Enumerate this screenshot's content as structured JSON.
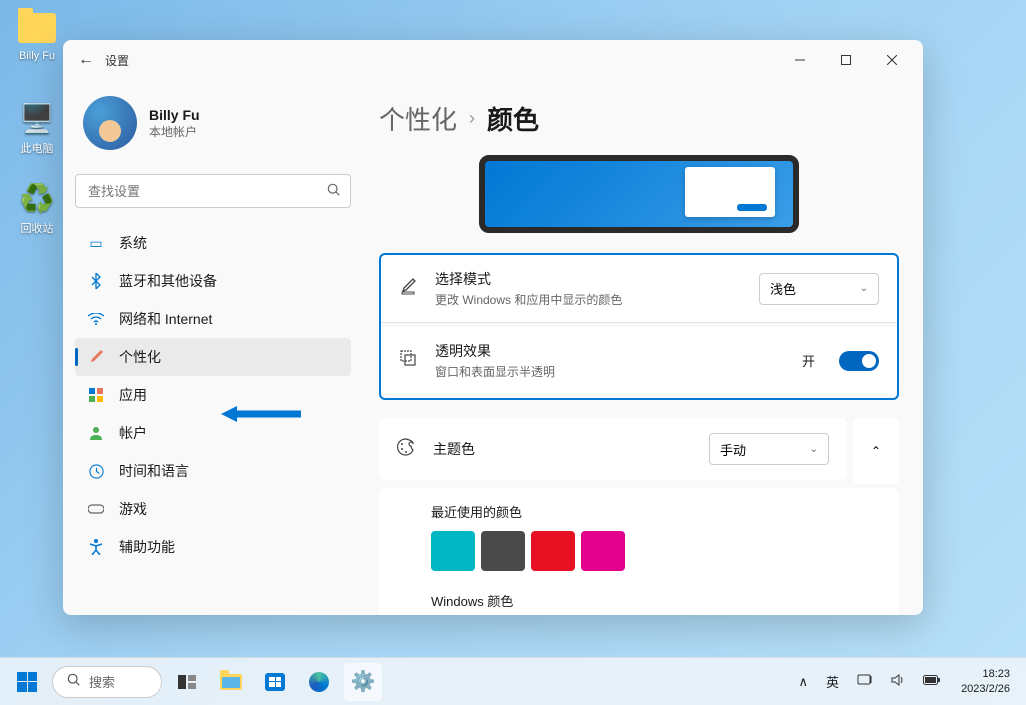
{
  "desktop": {
    "icons": [
      {
        "label": "Billy Fu",
        "type": "folder"
      },
      {
        "label": "此电脑",
        "type": "pc"
      },
      {
        "label": "回收站",
        "type": "recycle"
      }
    ]
  },
  "window": {
    "title": "设置",
    "back": "←"
  },
  "profile": {
    "name": "Billy Fu",
    "type": "本地帐户"
  },
  "search": {
    "placeholder": "查找设置"
  },
  "nav": [
    {
      "icon": "system",
      "label": "系统",
      "color": "#0078d4"
    },
    {
      "icon": "bluetooth",
      "label": "蓝牙和其他设备",
      "color": "#0078d4"
    },
    {
      "icon": "network",
      "label": "网络和 Internet",
      "color": "#0078d4"
    },
    {
      "icon": "personalize",
      "label": "个性化",
      "color": "#e8765c",
      "active": true
    },
    {
      "icon": "apps",
      "label": "应用",
      "color": "#0078d4"
    },
    {
      "icon": "accounts",
      "label": "帐户",
      "color": "#4caf50"
    },
    {
      "icon": "time",
      "label": "时间和语言",
      "color": "#0078d4"
    },
    {
      "icon": "gaming",
      "label": "游戏",
      "color": "#666"
    },
    {
      "icon": "accessibility",
      "label": "辅助功能",
      "color": "#0078d4"
    }
  ],
  "breadcrumb": {
    "parent": "个性化",
    "sep": "›",
    "current": "颜色"
  },
  "settings": {
    "mode": {
      "title": "选择模式",
      "sub": "更改 Windows 和应用中显示的颜色",
      "value": "浅色"
    },
    "transparency": {
      "title": "透明效果",
      "sub": "窗口和表面显示半透明",
      "state_label": "开",
      "on": true
    },
    "accent": {
      "title": "主题色",
      "value": "手动"
    },
    "recent": {
      "title": "最近使用的颜色",
      "colors": [
        "#00b7c3",
        "#4a4a4a",
        "#e81123",
        "#e3008c"
      ]
    },
    "windows_colors": {
      "title": "Windows 颜色",
      "colors": [
        "#ffb900",
        "#ff8c00",
        "#f7630c",
        "#ca5010",
        "#da3b01",
        "#ef6950",
        "#d13438",
        "#ff4343"
      ]
    }
  },
  "taskbar": {
    "search": "搜索",
    "ime_up": "∧",
    "ime_lang": "英",
    "time": "18:23",
    "date": "2023/2/26"
  }
}
